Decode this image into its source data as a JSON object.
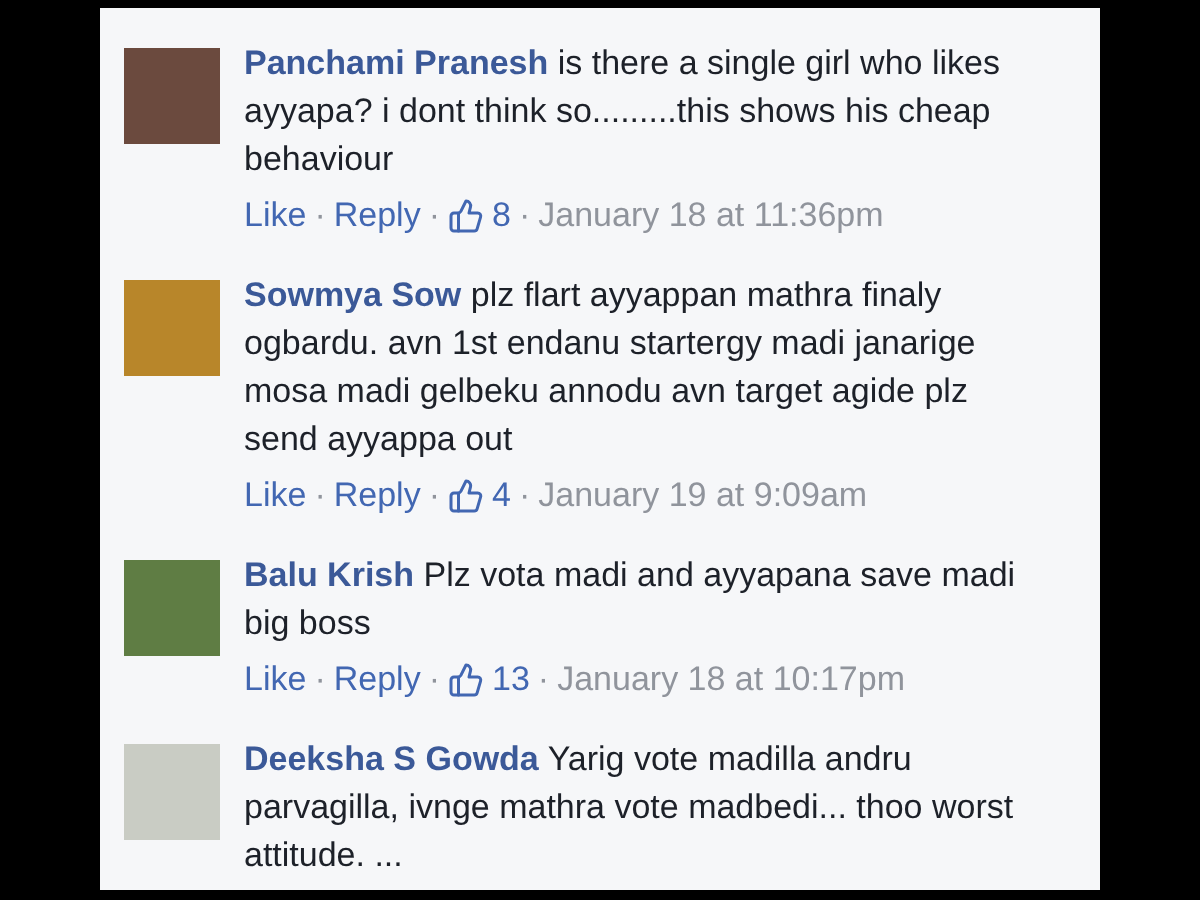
{
  "separator": "·",
  "comments": [
    {
      "author": "Panchami Pranesh",
      "text": "is there a single girl who likes ayyapa? i dont think so.........this shows his cheap behaviour",
      "actions": [
        "Like",
        "Reply"
      ],
      "likes": "8",
      "time": "January 18 at 11:36pm"
    },
    {
      "author": "Sowmya Sow",
      "text": "plz flart ayyappan mathra finaly ogbardu. avn 1st endanu startergy madi janarige mosa madi gelbeku annodu avn target agide plz send ayyappa out",
      "actions": [
        "Like",
        "Reply"
      ],
      "likes": "4",
      "time": "January 19 at 9:09am"
    },
    {
      "author": "Balu Krish",
      "text": "Plz vota madi and ayyapana save madi big boss",
      "actions": [
        "Like",
        "Reply"
      ],
      "likes": "13",
      "time": "January 18 at 10:17pm"
    },
    {
      "author": "Deeksha S Gowda",
      "text": "Yarig vote madilla andru parvagilla, ivnge mathra vote madbedi... thoo worst attitude. ..."
    }
  ]
}
